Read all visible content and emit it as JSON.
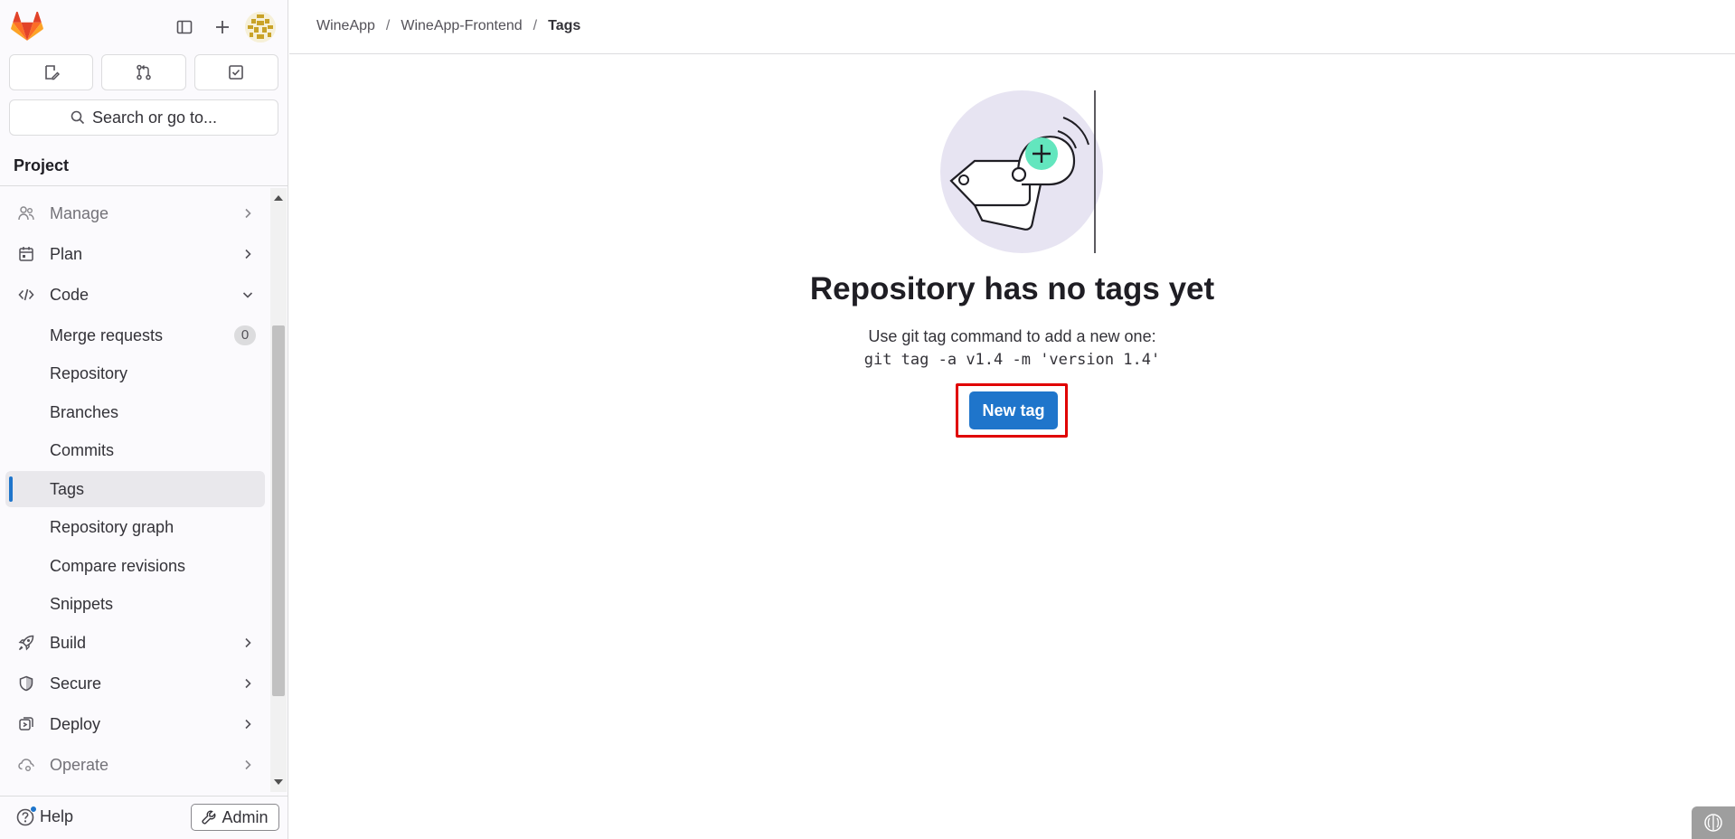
{
  "sidebar": {
    "search_label": "Search or go to...",
    "section_title": "Project",
    "nav": [
      {
        "label": "Manage",
        "icon": "users-icon"
      },
      {
        "label": "Plan",
        "icon": "calendar-icon"
      },
      {
        "label": "Code",
        "icon": "code-icon"
      }
    ],
    "code_items": [
      {
        "label": "Merge requests",
        "count": "0"
      },
      {
        "label": "Repository"
      },
      {
        "label": "Branches"
      },
      {
        "label": "Commits"
      },
      {
        "label": "Tags"
      },
      {
        "label": "Repository graph"
      },
      {
        "label": "Compare revisions"
      },
      {
        "label": "Snippets"
      }
    ],
    "bottom_nav": [
      {
        "label": "Build",
        "icon": "rocket-icon"
      },
      {
        "label": "Secure",
        "icon": "shield-icon"
      },
      {
        "label": "Deploy",
        "icon": "deployments-icon"
      },
      {
        "label": "Operate",
        "icon": "cloud-gear-icon"
      }
    ],
    "help_label": "Help",
    "admin_label": "Admin"
  },
  "breadcrumb": {
    "group": "WineApp",
    "project": "WineApp-Frontend",
    "current": "Tags"
  },
  "empty_state": {
    "title": "Repository has no tags yet",
    "description": "Use git tag command to add a new one:",
    "command": "git tag -a v1.4 -m 'version 1.4'",
    "button_label": "New tag"
  },
  "colors": {
    "primary": "#1f75cb",
    "highlight": "#e00000",
    "illustration_bg": "#e7e4f2",
    "illustration_accent": "#63e6be"
  }
}
